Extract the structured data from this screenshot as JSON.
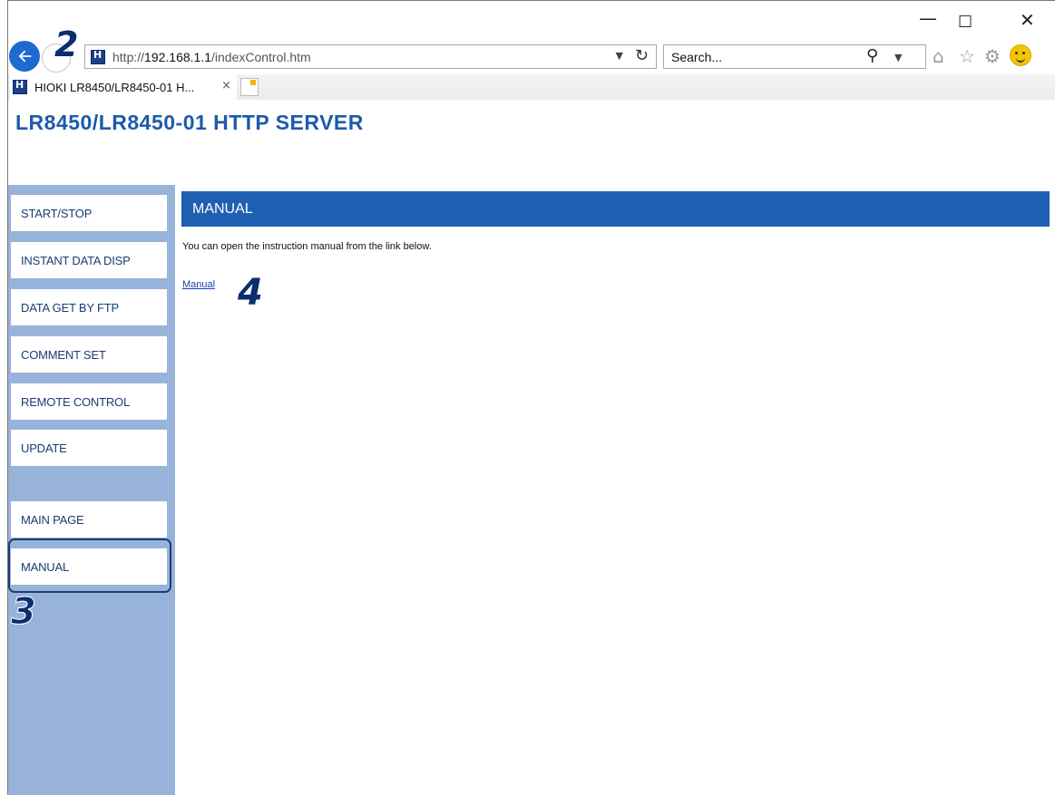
{
  "window": {
    "minimize_glyph": "—",
    "maximize_glyph": "☐",
    "close_glyph": "✕"
  },
  "browser": {
    "address": {
      "prefix": "http://",
      "host": "192.168.1.1",
      "path": "/indexControl.htm"
    },
    "search_placeholder": "Search...",
    "tab_label": "HIOKI LR8450/LR8450-01 H...",
    "tab_close": "×"
  },
  "callouts": {
    "step_2": "2",
    "step_3": "3",
    "step_4": "4"
  },
  "page": {
    "title": "LR8450/LR8450-01 HTTP SERVER"
  },
  "sidebar": {
    "items": [
      {
        "label": "START/STOP"
      },
      {
        "label": "INSTANT DATA DISP"
      },
      {
        "label": "DATA GET BY FTP"
      },
      {
        "label": "COMMENT SET"
      },
      {
        "label": "REMOTE CONTROL"
      },
      {
        "label": "UPDATE"
      },
      {
        "label": "MAIN PAGE"
      },
      {
        "label": "MANUAL"
      }
    ],
    "selected": "MANUAL"
  },
  "content": {
    "header": "MANUAL",
    "description": "You can open the instruction manual from the link below.",
    "link_label": "Manual"
  },
  "colors": {
    "accent_blue": "#1e5fb1",
    "sidebar_bg": "#98b3d9",
    "title_blue": "#1d5aab"
  }
}
